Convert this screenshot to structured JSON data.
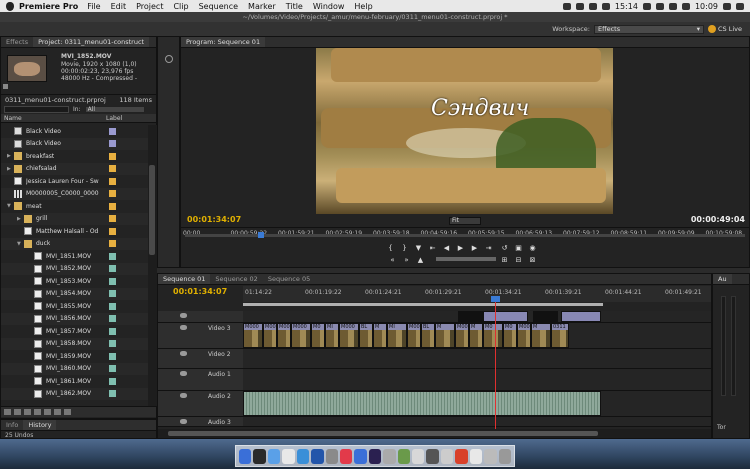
{
  "menubar": {
    "app_name": "Premiere Pro",
    "items": [
      "File",
      "Edit",
      "Project",
      "Clip",
      "Sequence",
      "Marker",
      "Title",
      "Window",
      "Help"
    ],
    "time": "15:14",
    "clock": "10:09"
  },
  "window": {
    "title": "~/Volumes/Video/Projects/_amur/menu-february/0311_menu01-construct.prproj *"
  },
  "workspace": {
    "label": "Workspace:",
    "value": "Effects",
    "cs_live": "CS Live"
  },
  "project_panel": {
    "tabs": [
      "Effects",
      "Project: 0311_menu01-construct"
    ],
    "clip": {
      "name": "MVI_1852.MOV",
      "info": [
        "Movie, 1920 x 1080 (1,0)",
        "00:00:02:23, 23,976 fps",
        "48000 Hz - Compressed -"
      ]
    },
    "project_file": "0311_menu01-construct.prproj",
    "item_count": "118 Items",
    "in_label": "In:",
    "in_value": "All",
    "columns": {
      "name": "Name",
      "label": "Label"
    },
    "items": [
      {
        "name": "Black Video",
        "icon": "video",
        "indent": 0,
        "color": "#9a9ad0",
        "twirl": ""
      },
      {
        "name": "Black Video",
        "icon": "video",
        "indent": 0,
        "color": "#9a9ad0",
        "twirl": ""
      },
      {
        "name": "breakfast",
        "icon": "folder",
        "indent": 0,
        "color": "#e8b040",
        "twirl": "▶"
      },
      {
        "name": "chiefsalad",
        "icon": "folder",
        "indent": 0,
        "color": "#e8b040",
        "twirl": "▶"
      },
      {
        "name": "Jessica Lauren Four - Sw",
        "icon": "mov",
        "indent": 0,
        "color": "#e8b040",
        "twirl": ""
      },
      {
        "name": "M0000005_C0000_0000",
        "icon": "bars",
        "indent": 0,
        "color": "#e8b040",
        "twirl": ""
      },
      {
        "name": "meat",
        "icon": "folder",
        "indent": 0,
        "color": "#e8b040",
        "twirl": "▼"
      },
      {
        "name": "grill",
        "icon": "folder",
        "indent": 1,
        "color": "#e8b040",
        "twirl": "▶"
      },
      {
        "name": "Matthew Halsall - Od",
        "icon": "mov",
        "indent": 1,
        "color": "#e8b040",
        "twirl": ""
      },
      {
        "name": "duck",
        "icon": "folder",
        "indent": 1,
        "color": "#e8b040",
        "twirl": "▼"
      },
      {
        "name": "MVI_1851.MOV",
        "icon": "mov",
        "indent": 2,
        "color": "#7fbfb0",
        "twirl": ""
      },
      {
        "name": "MVI_1852.MOV",
        "icon": "mov",
        "indent": 2,
        "color": "#7fbfb0",
        "twirl": ""
      },
      {
        "name": "MVI_1853.MOV",
        "icon": "mov",
        "indent": 2,
        "color": "#7fbfb0",
        "twirl": ""
      },
      {
        "name": "MVI_1854.MOV",
        "icon": "mov",
        "indent": 2,
        "color": "#7fbfb0",
        "twirl": ""
      },
      {
        "name": "MVI_1855.MOV",
        "icon": "mov",
        "indent": 2,
        "color": "#7fbfb0",
        "twirl": ""
      },
      {
        "name": "MVI_1856.MOV",
        "icon": "mov",
        "indent": 2,
        "color": "#7fbfb0",
        "twirl": ""
      },
      {
        "name": "MVI_1857.MOV",
        "icon": "mov",
        "indent": 2,
        "color": "#7fbfb0",
        "twirl": ""
      },
      {
        "name": "MVI_1858.MOV",
        "icon": "mov",
        "indent": 2,
        "color": "#7fbfb0",
        "twirl": ""
      },
      {
        "name": "MVI_1859.MOV",
        "icon": "mov",
        "indent": 2,
        "color": "#7fbfb0",
        "twirl": ""
      },
      {
        "name": "MVI_1860.MOV",
        "icon": "mov",
        "indent": 2,
        "color": "#7fbfb0",
        "twirl": ""
      },
      {
        "name": "MVI_1861.MOV",
        "icon": "mov",
        "indent": 2,
        "color": "#7fbfb0",
        "twirl": ""
      },
      {
        "name": "MVI_1862.MOV",
        "icon": "mov",
        "indent": 2,
        "color": "#7fbfb0",
        "twirl": ""
      }
    ]
  },
  "history_panel": {
    "tabs": [
      "Info",
      "History"
    ],
    "undos": "25 Undos"
  },
  "program_monitor": {
    "tab": "Program: Sequence 01",
    "overlay_title": "Сэндвич",
    "current_tc": "00:01:34:07",
    "duration_tc": "00:00:49:04",
    "fit": "Fit",
    "ruler": [
      "00:00",
      "00:00:59:22",
      "00:01:59:21",
      "00:02:59:19",
      "00:03:59:18",
      "00:04:59:16",
      "00:05:59:15",
      "00:06:59:13",
      "00:07:59:12",
      "00:08:59:11",
      "00:09:59:09",
      "00:10:59:08"
    ]
  },
  "timeline": {
    "tabs": [
      "Sequence 01",
      "Sequence 02",
      "Sequence 05"
    ],
    "current_tc": "00:01:34:07",
    "ruler": [
      "01:14:22",
      "00:01:19:22",
      "00:01:24:21",
      "00:01:29:21",
      "00:01:34:21",
      "00:01:39:21",
      "00:01:44:21",
      "00:01:49:21"
    ],
    "tracks": [
      {
        "name": "",
        "kind": "v-empty"
      },
      {
        "name": "Video 3",
        "kind": "video"
      },
      {
        "name": "Video 2",
        "kind": "empty"
      },
      {
        "name": "Audio 1",
        "kind": "empty"
      },
      {
        "name": "Audio 2",
        "kind": "audio"
      },
      {
        "name": "Audio 3",
        "kind": "empty"
      }
    ],
    "clip_labels": [
      "M000",
      "M000",
      "M000",
      "M000",
      "M0",
      "MI",
      "M000",
      "BL",
      "M",
      "MI",
      "M00",
      "BL",
      "M",
      "M00",
      "M",
      "M0",
      "M0",
      "M000",
      "M",
      "0311"
    ]
  },
  "audio_meters": {
    "tab": "Au",
    "tone_label": "Tor"
  }
}
